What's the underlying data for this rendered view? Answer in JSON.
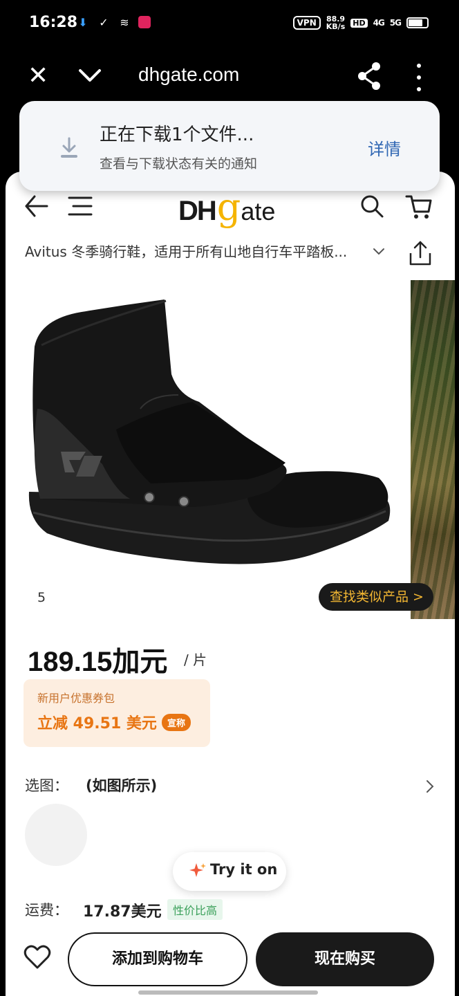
{
  "status_bar": {
    "time": "16:28",
    "vpn": "VPN",
    "speed_value": "88.9",
    "speed_unit": "KB/s",
    "hd": "HD",
    "signal1": "4G",
    "signal2": "5G"
  },
  "browser": {
    "domain": "dhgate.com"
  },
  "notification": {
    "title": "正在下载1个文件...",
    "subtitle": "查看与下载状态有关的通知",
    "action": "详情"
  },
  "header": {
    "logo_dh": "DH",
    "logo_g": "g",
    "logo_ate": "ate"
  },
  "product": {
    "title": "Avitus 冬季骑行鞋，适用于所有山地自行车平踏板...",
    "image_index": "5",
    "find_similar": "查找类似产品 >",
    "price": "189.15加元",
    "unit": "/ 片",
    "coupon_label": "新用户优惠券包",
    "coupon_value": "立减 49.51 美元",
    "coupon_badge": "宣称",
    "select_label": "选图：",
    "select_value": "(如图所示)",
    "try_on": "Try it on",
    "shipping_label": "运费：",
    "shipping_value": "17.87美元",
    "shipping_tag": "性价比高"
  },
  "actions": {
    "add_to_cart": "添加到购物车",
    "buy_now": "现在购买"
  },
  "colors": {
    "accent_orange": "#e87513",
    "logo_yellow": "#f5b400",
    "link_blue": "#2f66b3",
    "dark": "#1a1a1a"
  }
}
